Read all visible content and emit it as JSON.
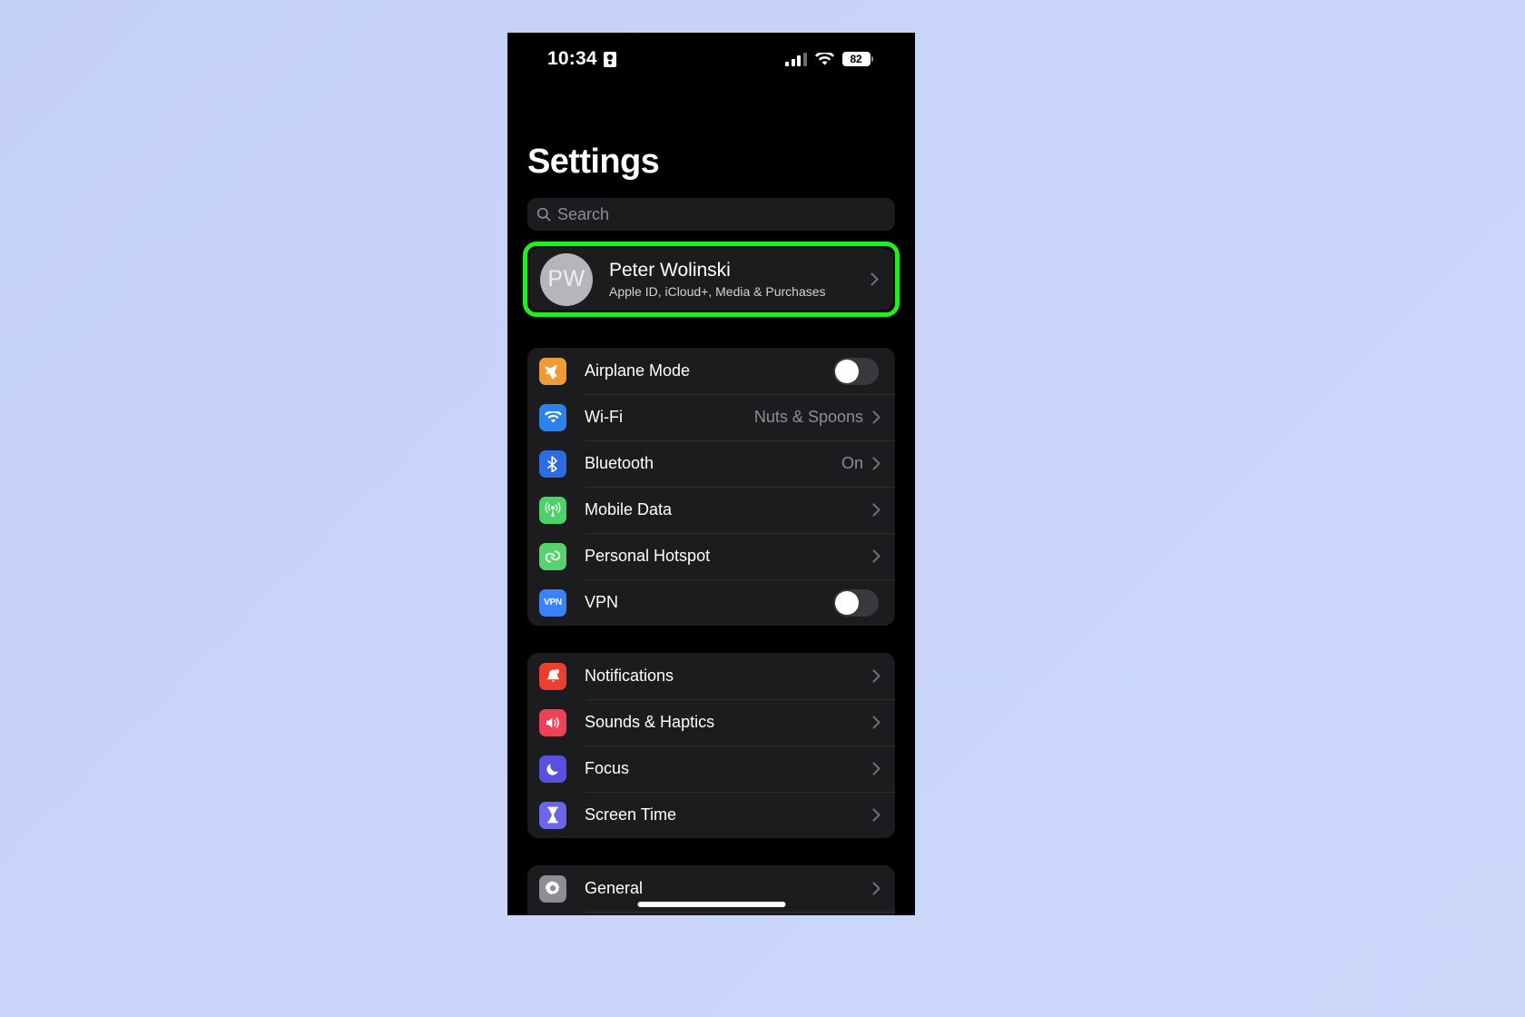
{
  "statusbar": {
    "time": "10:34",
    "location_icon": "location-badge-icon",
    "signal_icon": "cellular-signal-icon",
    "wifi_icon": "wifi-icon",
    "battery_level": "82"
  },
  "header": {
    "title": "Settings"
  },
  "search": {
    "placeholder": "Search",
    "value": "",
    "icon": "search-icon"
  },
  "account": {
    "initials": "PW",
    "name": "Peter Wolinski",
    "subtitle": "Apple ID, iCloud+, Media & Purchases",
    "chevron": "chevron-right-icon",
    "highlight_color": "#20ee20",
    "highlighted": true
  },
  "groups": [
    {
      "name": "connectivity",
      "rows": [
        {
          "label": "Airplane Mode",
          "icon": "airplane-icon",
          "icon_color": "#f09a36",
          "control": "toggle",
          "toggle_on": false
        },
        {
          "label": "Wi-Fi",
          "icon": "wifi-icon",
          "icon_color": "#2b82ea",
          "control": "chevron",
          "detail": "Nuts & Spoons"
        },
        {
          "label": "Bluetooth",
          "icon": "bluetooth-icon",
          "icon_color": "#2b6ce0",
          "control": "chevron",
          "detail": "On"
        },
        {
          "label": "Mobile Data",
          "icon": "antenna-icon",
          "icon_color": "#4cd268",
          "control": "chevron",
          "detail": ""
        },
        {
          "label": "Personal Hotspot",
          "icon": "hotspot-link-icon",
          "icon_color": "#56d26f",
          "control": "chevron",
          "detail": ""
        },
        {
          "label": "VPN",
          "icon": "vpn-icon",
          "icon_color": "#3b82f6",
          "control": "toggle",
          "toggle_on": false
        }
      ]
    },
    {
      "name": "alerts",
      "rows": [
        {
          "label": "Notifications",
          "icon": "bell-icon",
          "icon_color": "#eb3f32",
          "control": "chevron",
          "detail": ""
        },
        {
          "label": "Sounds & Haptics",
          "icon": "speaker-icon",
          "icon_color": "#ec4257",
          "control": "chevron",
          "detail": ""
        },
        {
          "label": "Focus",
          "icon": "moon-icon",
          "icon_color": "#5a50e0",
          "control": "chevron",
          "detail": ""
        },
        {
          "label": "Screen Time",
          "icon": "hourglass-icon",
          "icon_color": "#6a66e8",
          "control": "chevron",
          "detail": ""
        }
      ]
    },
    {
      "name": "system",
      "rows": [
        {
          "label": "General",
          "icon": "gear-icon",
          "icon_color": "#8d8d93",
          "control": "chevron",
          "detail": ""
        }
      ]
    }
  ],
  "home_indicator": "home-indicator"
}
